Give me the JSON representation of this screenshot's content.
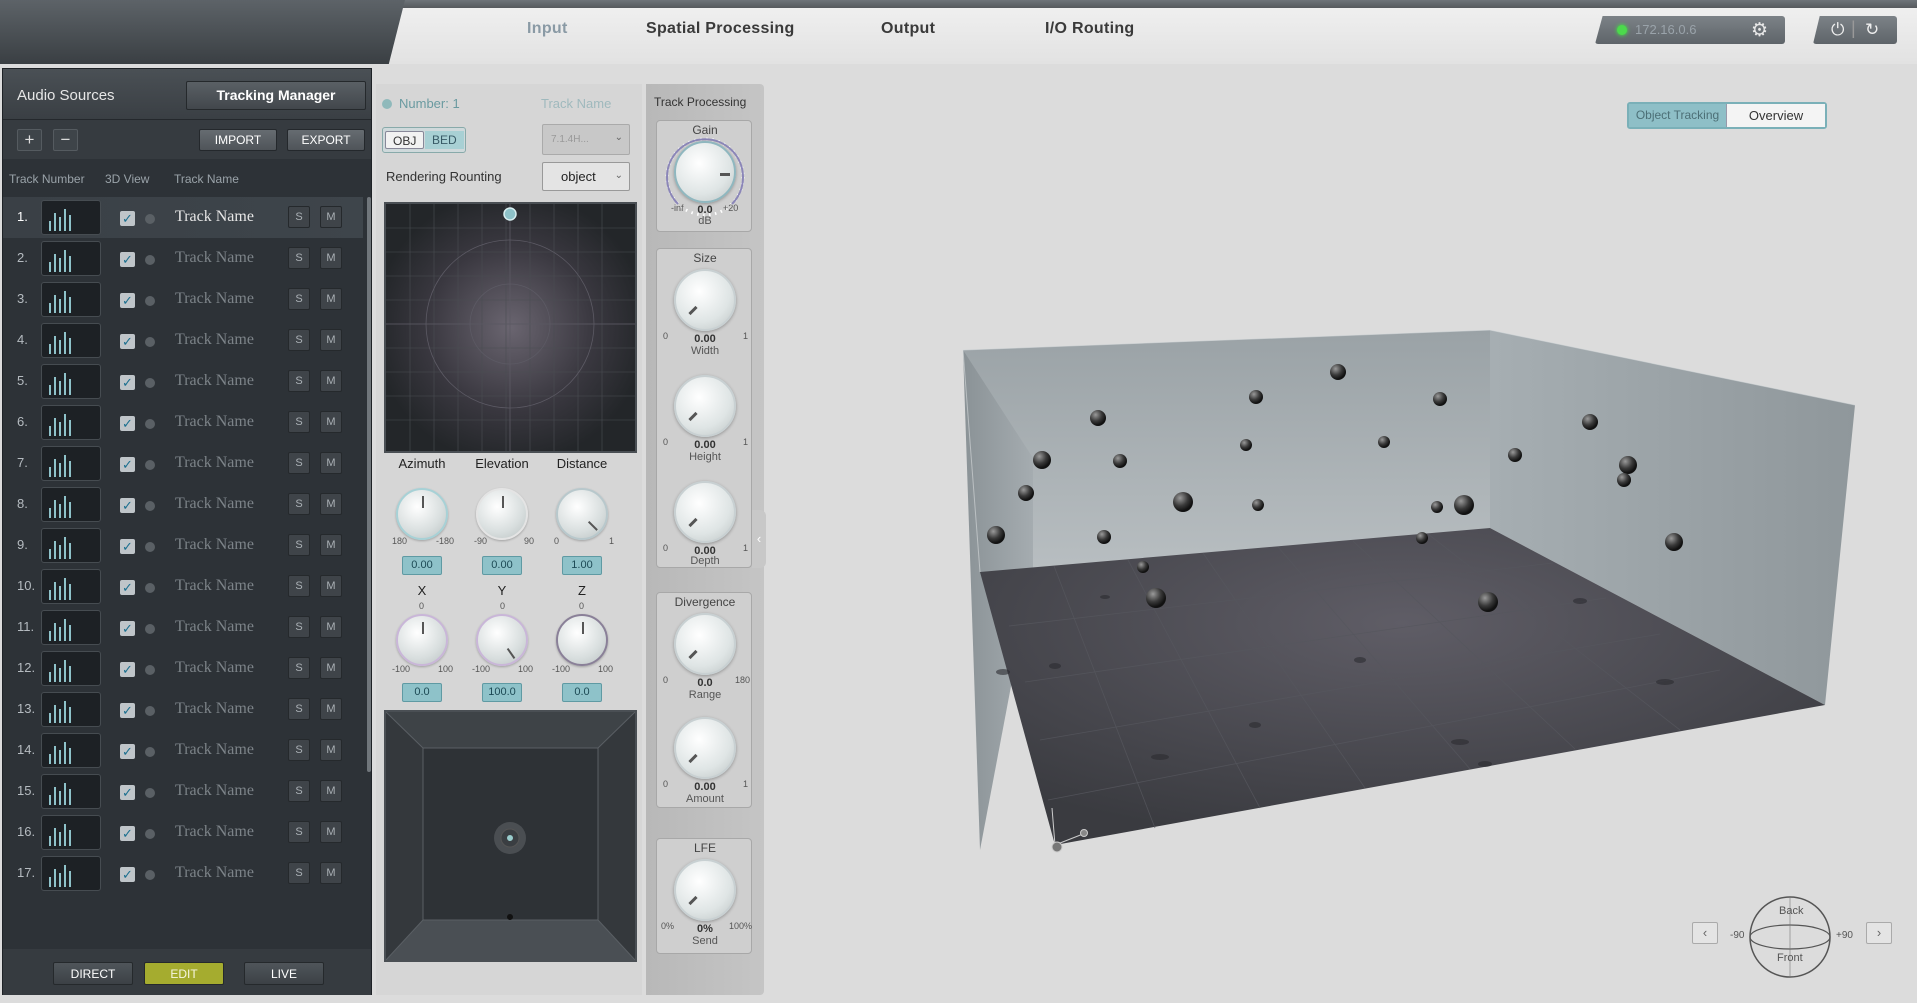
{
  "nav": {
    "tabs": [
      "Input",
      "Spatial Processing",
      "Output",
      "I/O Routing"
    ],
    "active_tab": "Input",
    "ip_address": "172.16.0.6"
  },
  "audio_sources": {
    "title": "Audio Sources",
    "tracking_manager_label": "Tracking Manager",
    "add_label": "+",
    "remove_label": "−",
    "import_label": "IMPORT",
    "export_label": "EXPORT",
    "columns": {
      "track_number": "Track Number",
      "view_3d": "3D View",
      "track_name": "Track Name"
    },
    "tracks": [
      {
        "num": "1.",
        "name": "Track Name",
        "selected": true
      },
      {
        "num": "2.",
        "name": "Track Name"
      },
      {
        "num": "3.",
        "name": "Track Name"
      },
      {
        "num": "4.",
        "name": "Track Name"
      },
      {
        "num": "5.",
        "name": "Track Name"
      },
      {
        "num": "6.",
        "name": "Track Name"
      },
      {
        "num": "7.",
        "name": "Track Name"
      },
      {
        "num": "8.",
        "name": "Track Name"
      },
      {
        "num": "9.",
        "name": "Track Name"
      },
      {
        "num": "10.",
        "name": "Track Name"
      },
      {
        "num": "11.",
        "name": "Track Name"
      },
      {
        "num": "12.",
        "name": "Track Name"
      },
      {
        "num": "13.",
        "name": "Track Name"
      },
      {
        "num": "14.",
        "name": "Track Name"
      },
      {
        "num": "15.",
        "name": "Track Name"
      },
      {
        "num": "16.",
        "name": "Track Name"
      },
      {
        "num": "17.",
        "name": "Track Name"
      }
    ],
    "solo_label": "S",
    "mute_label": "M",
    "modes": [
      "DIRECT",
      "EDIT",
      "LIVE"
    ],
    "active_mode": "EDIT"
  },
  "object_editor": {
    "number_label": "Number: 1",
    "track_name_label": "Track Name",
    "obj_label": "OBJ",
    "bed_label": "BED",
    "format_value": "7.1.4H...",
    "rendering_label": "Rendering Rounting",
    "rendering_value": "object",
    "azimuth": {
      "label": "Azimuth",
      "min": "180",
      "max": "-180",
      "value": "0.00"
    },
    "elevation": {
      "label": "Elevation",
      "min": "-90",
      "max": "90",
      "value": "0.00"
    },
    "distance": {
      "label": "Distance",
      "min": "0",
      "max": "1",
      "value": "1.00"
    },
    "x": {
      "label": "X",
      "top": "0",
      "min": "-100",
      "max": "100",
      "value": "0.0"
    },
    "y": {
      "label": "Y",
      "top": "0",
      "min": "-100",
      "max": "100",
      "value": "100.0"
    },
    "z": {
      "label": "Z",
      "top": "0",
      "min": "-100",
      "max": "100",
      "value": "0.0"
    }
  },
  "track_processing": {
    "title": "Track Processing",
    "gain": {
      "title": "Gain",
      "min": "-inf",
      "max": "+20",
      "value": "0.0",
      "unit": "dB"
    },
    "size_title": "Size",
    "width": {
      "min": "0",
      "max": "1",
      "value": "0.00",
      "label": "Width"
    },
    "height": {
      "min": "0",
      "max": "1",
      "value": "0.00",
      "label": "Height"
    },
    "depth": {
      "min": "0",
      "max": "1",
      "value": "0.00",
      "label": "Depth"
    },
    "divergence_title": "Divergence",
    "range": {
      "min": "0",
      "max": "180",
      "value": "0.0",
      "label": "Range"
    },
    "amount": {
      "min": "0",
      "max": "1",
      "value": "0.00",
      "label": "Amount"
    },
    "lfe_title": "LFE",
    "send": {
      "min": "0%",
      "max": "100%",
      "value": "0%",
      "label": "Send"
    }
  },
  "view": {
    "object_tracking_label": "Object Tracking",
    "overview_label": "Overview",
    "nav_back": "Back",
    "nav_front": "Front",
    "nav_left_deg": "-90",
    "nav_right_deg": "+90"
  },
  "colors": {
    "accent": "#8ec2c9",
    "edit_mode": "#a5ac2f",
    "status_ok": "#4cd94c"
  }
}
